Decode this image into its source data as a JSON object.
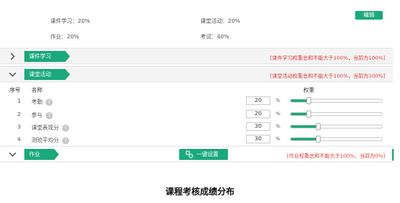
{
  "summary": {
    "courseware": "课件学习：20%",
    "classroom": "课堂活动：20%",
    "homework": "作业：20%",
    "exam": "考试：40%",
    "edit_label": "编辑"
  },
  "sections": {
    "courseware": {
      "label": "课件学习",
      "warning": "[课件学习权重总和不能大于100%，当前为100%]"
    },
    "classroom": {
      "label": "课堂活动",
      "warning": "[课堂活动权重总和不能大于100%，当前为100%]"
    },
    "homework": {
      "label": "作业",
      "oneclick_label": "一键设置",
      "warning": "[作业权重总和不能大于100%，当前为0%]"
    }
  },
  "table": {
    "headers": {
      "index": "序号",
      "name": "名称",
      "weight": "权重"
    },
    "unit": "%",
    "help_glyph": "?",
    "rows": [
      {
        "index": "1",
        "name": "考勤",
        "value": "20",
        "level": 0.2
      },
      {
        "index": "2",
        "name": "参与",
        "value": "20",
        "level": 0.2
      },
      {
        "index": "3",
        "name": "课堂表现分",
        "value": "30",
        "level": 0.3
      },
      {
        "index": "4",
        "name": "测验平均分",
        "value": "30",
        "level": 0.3
      }
    ]
  },
  "caption": "课程考核成绩分布",
  "colors": {
    "accent": "#1aa97b",
    "warning": "#e53b3b"
  }
}
